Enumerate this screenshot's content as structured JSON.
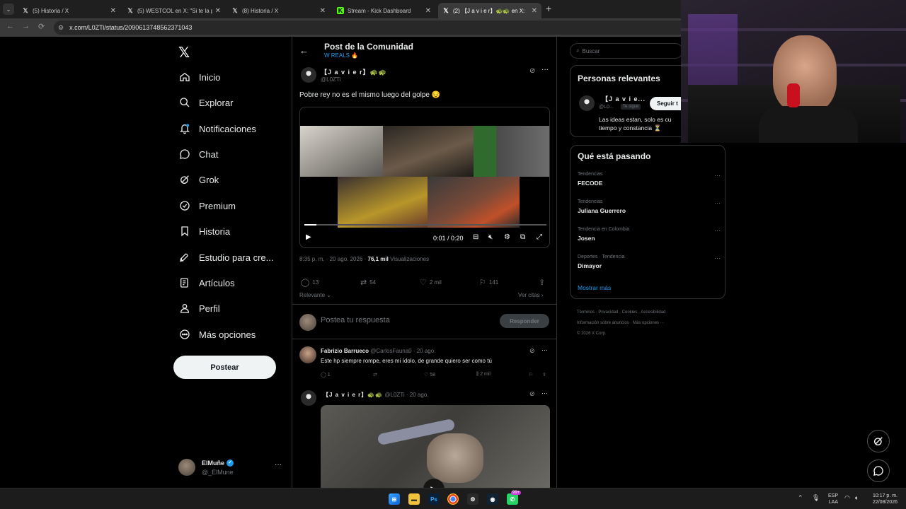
{
  "browser": {
    "tabs": [
      {
        "title": "(5) Historia / X",
        "icon": "x-logo-icon"
      },
      {
        "title": "(5) WESTCOL en X: \"Si te la pasa",
        "icon": "x-logo-icon"
      },
      {
        "title": "(8) Historia / X",
        "icon": "x-logo-icon"
      },
      {
        "title": "Stream - Kick Dashboard",
        "icon": "kick-logo-icon"
      },
      {
        "title": "(2) 【J a v i e r】🐢🐢 en X:",
        "icon": "x-logo-icon",
        "active": true
      }
    ],
    "url": "x.com/L0ZTi/status/2090613748562371043"
  },
  "sidebar": {
    "items": [
      {
        "label": "Inicio",
        "icon": "home-icon"
      },
      {
        "label": "Explorar",
        "icon": "search-icon"
      },
      {
        "label": "Notificaciones",
        "icon": "bell-icon"
      },
      {
        "label": "Chat",
        "icon": "chat-bubble-icon"
      },
      {
        "label": "Grok",
        "icon": "grok-icon"
      },
      {
        "label": "Premium",
        "icon": "verified-badge-icon"
      },
      {
        "label": "Historia",
        "icon": "bookmark-icon"
      },
      {
        "label": "Estudio para cre...",
        "icon": "rocket-icon"
      },
      {
        "label": "Artículos",
        "icon": "article-icon"
      },
      {
        "label": "Perfil",
        "icon": "person-icon"
      },
      {
        "label": "Más opciones",
        "icon": "more-circle-icon"
      }
    ],
    "post_button": "Postear",
    "account": {
      "name": "ElMuñe",
      "handle": "@_ElMune"
    }
  },
  "post": {
    "header_title": "Post de la Comunidad",
    "community": "W REALS 🔥",
    "author_name": "【J a v i e r】🐢🐢",
    "author_handle": "@L0ZTi",
    "text": "Pobre rey no es el mismo luego del golpe 😔",
    "video_time": "0:01 / 0:20",
    "video_progress": 0.05,
    "time": "8:35 p. m. · 20 ago. 2026 ·",
    "views_count": "76,1 mil",
    "views_label": "Visualizaciones",
    "stats": {
      "replies": "13",
      "reposts": "54",
      "likes": "2 mil",
      "bookmarks": "141"
    },
    "sort_label": "Relevante",
    "quotes_label": "Ver citas",
    "reply_placeholder": "Postea tu respuesta",
    "reply_button": "Responder"
  },
  "replies": [
    {
      "name": "Fabrizio Barrueco",
      "handle": "@CarlosFauna0 · 20 ago.",
      "text": "Este hp siempre rompe, eres mi ídolo, de grande quiero ser como tú",
      "replies": "1",
      "likes": "58",
      "views": "2 mil"
    },
    {
      "name": "【J a v i e r】🐢🐢",
      "handle": "@L0ZTi · 20 ago."
    }
  ],
  "right": {
    "search_placeholder": "Buscar",
    "relevant_title": "Personas relevantes",
    "relevant_person": {
      "name": "【J a v i e...",
      "handle": "@L0...",
      "follows_you": "Te sigue",
      "follow_button": "Seguir t",
      "bio": "Las ideas estan, solo es cu tiempo y constancia ⏳"
    },
    "trends_title": "Qué está pasando",
    "trends": [
      {
        "context": "Tendencias",
        "name": "FECODE"
      },
      {
        "context": "Tendencias",
        "name": "Juliana Guerrero"
      },
      {
        "context": "Tendencia en Colombia",
        "name": "Josen"
      },
      {
        "context": "Deportes · Tendencia",
        "name": "Dimayor"
      }
    ],
    "show_more": "Mostrar más",
    "footer": {
      "line1": "Términos · Privacidad · Cookies · Accesibilidad ·",
      "line2": "Información sobre anuncios · Más opciones ···",
      "line3": "© 2026 X Corp."
    }
  },
  "taskbar": {
    "lang_top": "ESP",
    "lang_bottom": "LAA",
    "time": "10:17 p. m.",
    "date": "22/08/2026",
    "badge": "99+"
  },
  "colors": {
    "accent": "#1d9bf0",
    "background": "#000000",
    "border": "#2f3336"
  }
}
